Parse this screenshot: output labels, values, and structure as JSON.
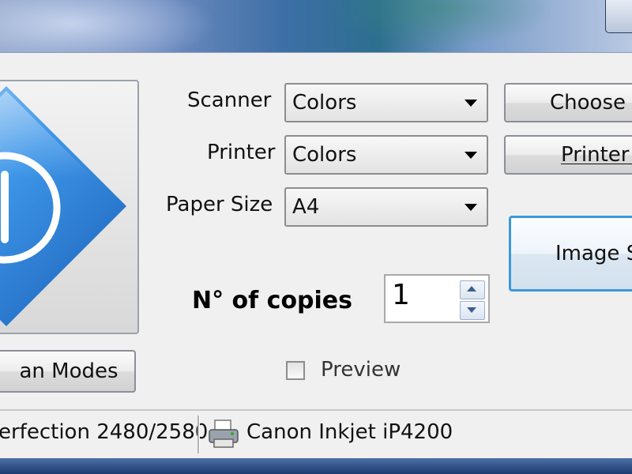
{
  "scan_modes_label": "an Modes",
  "form": {
    "scanner_label": "Scanner",
    "scanner_value": "Colors",
    "printer_label": "Printer",
    "printer_value": "Colors",
    "paper_label": "Paper Size",
    "paper_value": "A4"
  },
  "buttons": {
    "choose_scanner": "Choose s",
    "printer_options": "Printer o",
    "image_settings": "Image Se"
  },
  "copies": {
    "label": "N° of copies",
    "value": "1"
  },
  "preview_label": "Preview",
  "status": {
    "scanner": "erfection 2480/2580",
    "printer": "Canon Inkjet iP4200"
  },
  "icons": {
    "logo": "power-diamond-icon",
    "printer": "printer-icon"
  },
  "colors": {
    "logo_blue": "#2f7fd6",
    "window_bg": "#f0f0f0"
  }
}
